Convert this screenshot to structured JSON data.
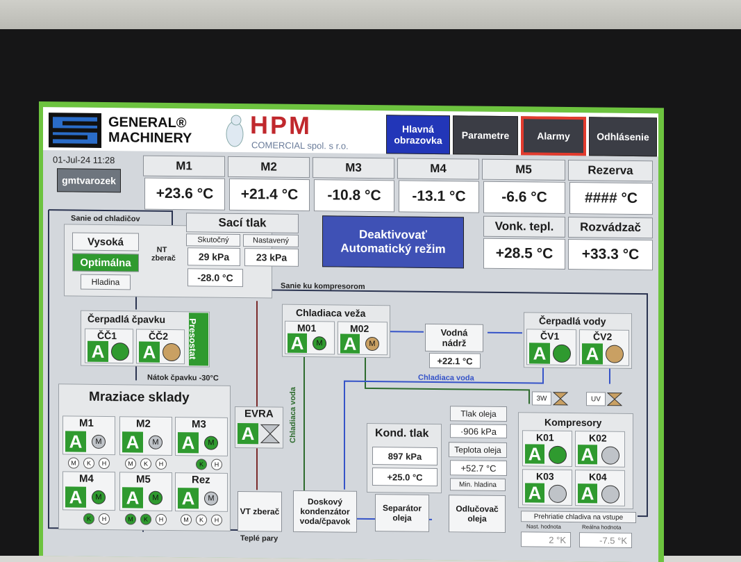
{
  "colors": {
    "accent": "#6dc33f",
    "on": "#2f9a2f",
    "tan": "#c9a063",
    "blue_btn": "#3f51b5",
    "alarm_border": "#e23b2e"
  },
  "brand": {
    "general_machinery": "GENERAL® MACHINERY",
    "hpm": "HPM",
    "hpm_sub": "COMERCIAL spol. s r.o."
  },
  "datetime": "01-Jul-24 11:28",
  "user": "gmtvarozek",
  "nav": {
    "main": "Hlavná obrazovka",
    "params": "Parametre",
    "alarms": "Alarmy",
    "logout": "Odhlásenie"
  },
  "temps": [
    {
      "label": "M1",
      "value": "+23.6 °C"
    },
    {
      "label": "M2",
      "value": "+21.4 °C"
    },
    {
      "label": "M3",
      "value": "-10.8 °C"
    },
    {
      "label": "M4",
      "value": "-13.1 °C"
    },
    {
      "label": "M5",
      "value": "-6.6 °C"
    },
    {
      "label": "Rezerva",
      "value": "#### °C"
    }
  ],
  "outdoor": {
    "label": "Vonk. tepl.",
    "value": "+28.5 °C"
  },
  "switchboard": {
    "label": "Rozvádzač",
    "value": "+33.3 °C"
  },
  "auto_button": "Deaktivovať Automatický režim",
  "suction_from_coolers": "Sanie od chladičov",
  "levels": {
    "high": "Vysoká",
    "optimal": "Optimálna",
    "level": "Hladina"
  },
  "nt": "NT zberač",
  "suction_pressure": {
    "title": "Sací tlak",
    "actual_label": "Skutočný",
    "set_label": "Nastavený",
    "actual": "29 kPa",
    "set": "23 kPa",
    "temp": "-28.0 °C"
  },
  "suction_to_compressors": "Sanie ku kompresorom",
  "ammonia_pumps": {
    "title": "Čerpadlá čpavku",
    "pumps": [
      "ČČ1",
      "ČČ2"
    ],
    "presostat": "Presostat"
  },
  "ammonia_inflow": "Nátok čpavku -30°C",
  "cold_stores": {
    "title": "Mraziace sklady",
    "rooms": [
      "M1",
      "M2",
      "M3",
      "M4",
      "M5",
      "Rez"
    ]
  },
  "marker_letters": [
    "M",
    "K",
    "H"
  ],
  "evra": "EVRA",
  "cooling_water_vertical": "Chladiaca voda",
  "cooling_tower": {
    "title": "Chladiaca veža",
    "fans": [
      "M01",
      "M02"
    ]
  },
  "water_tank": {
    "title": "Vodná nádrž",
    "value": "+22.1 °C"
  },
  "water_pumps": {
    "title": "Čerpadlá vody",
    "pumps": [
      "ČV1",
      "ČV2"
    ]
  },
  "cooling_water": "Chladiaca voda",
  "valves": [
    "3W",
    "UV"
  ],
  "compressors": {
    "title": "Kompresory",
    "units": [
      "K01",
      "K02",
      "K03",
      "K04"
    ]
  },
  "oil": {
    "pressure_label": "Tlak oleja",
    "pressure": "·906 kPa",
    "temp_label": "Teplota oleja",
    "temp": "+52.7 °C",
    "min_level": "Min. hladina"
  },
  "cond": {
    "title": "Kond. tlak",
    "pressure": "897 kPa",
    "temp": "+25.0 °C"
  },
  "superheat": {
    "title": "Prehriatie chladiva na vstupe",
    "set_label": "Nast. hodnota",
    "real_label": "Reálna hodnota",
    "set": "2 °K",
    "real": "-7.5 °K"
  },
  "hp_receiver": "VT zberač",
  "condenser": "Doskový kondenzátor voda/čpavok",
  "separator": "Separátor oleja",
  "oil_drain": "Odlučovač oleja",
  "warm_vapors": "Teplé pary",
  "a_label": "A"
}
